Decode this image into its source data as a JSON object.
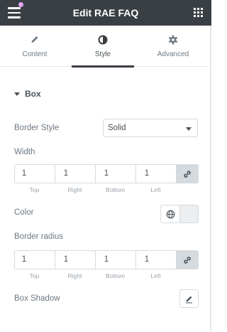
{
  "header": {
    "title": "Edit RAE FAQ",
    "menu_icon": "hamburger-icon",
    "apps_icon": "grid-icon"
  },
  "tabs": [
    {
      "label": "Content",
      "icon": "pencil-icon"
    },
    {
      "label": "Style",
      "icon": "contrast-icon",
      "active": true
    },
    {
      "label": "Advanced",
      "icon": "gear-icon"
    }
  ],
  "section": {
    "title": "Box"
  },
  "border_style": {
    "label": "Border Style",
    "value": "Solid"
  },
  "width": {
    "label": "Width",
    "values": [
      "1",
      "1",
      "1",
      "1"
    ],
    "sides": [
      "Top",
      "Right",
      "Bottom",
      "Left"
    ]
  },
  "color": {
    "label": "Color"
  },
  "border_radius": {
    "label": "Border radius",
    "values": [
      "1",
      "1",
      "1",
      "1"
    ],
    "sides": [
      "Top",
      "Right",
      "Bottom",
      "Left"
    ]
  },
  "box_shadow": {
    "label": "Box Shadow"
  },
  "colors": {
    "header_bg": "#3a3f44",
    "accent_dot": "#e8a4f2",
    "link_btn_bg": "#d5dadf"
  }
}
